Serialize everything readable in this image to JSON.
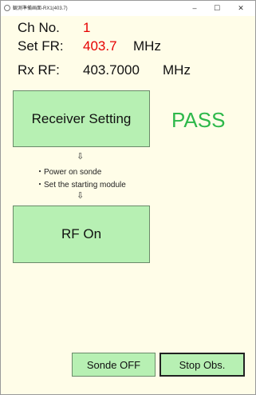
{
  "window": {
    "title": "観測準備画面-RX1(403.7)",
    "minimize": "–",
    "maximize": "☐",
    "close": "✕"
  },
  "channel": {
    "label": "Ch No.",
    "value": "1"
  },
  "set_fr": {
    "label": "Set FR:",
    "value": "403.7",
    "unit": "MHz"
  },
  "rx_rf": {
    "label": "Rx RF:",
    "value": "403.7000",
    "unit": "MHz"
  },
  "buttons": {
    "receiver_setting": "Receiver Setting",
    "rf_on": "RF On",
    "sonde_off": "Sonde OFF",
    "stop_obs": "Stop Obs."
  },
  "status": {
    "text": "PASS",
    "color": "#2db84a"
  },
  "instructions": {
    "arrow": "⇩",
    "steps": [
      "・Power on sonde",
      "・Set the starting module"
    ]
  },
  "icons": [
    "app-icon",
    "minimize-icon",
    "maximize-icon",
    "close-icon",
    "down-arrow-icon"
  ]
}
